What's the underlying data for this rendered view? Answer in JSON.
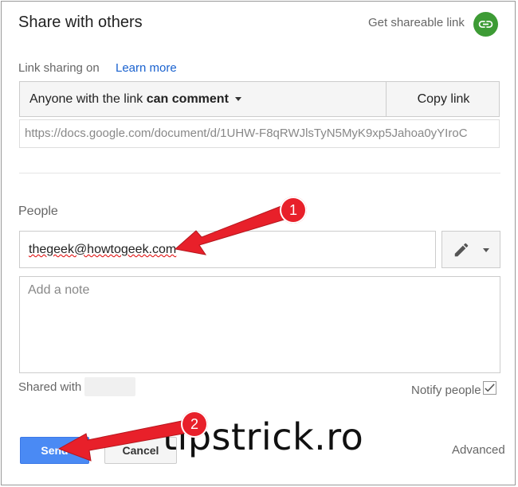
{
  "dialog": {
    "title": "Share with others",
    "get_shareable_link": "Get shareable link",
    "link_icon": "link-icon"
  },
  "link_sharing": {
    "status": "Link sharing on",
    "learn_more": "Learn more",
    "permission_prefix": "Anyone with the link ",
    "permission_level": "can comment",
    "copy_link": "Copy link",
    "url": "https://docs.google.com/document/d/1UHW-F8qRWJlsTyN5MyK9xp5Jahoa0yYIroC"
  },
  "people": {
    "label": "People",
    "input_value": "thegeek@howtogeek.com",
    "edit_icon": "pencil-icon",
    "note_placeholder": "Add a note"
  },
  "footer": {
    "shared_with": "Shared with",
    "notify_people": "Notify people",
    "notify_checked": true,
    "send": "Send",
    "cancel": "Cancel",
    "advanced": "Advanced"
  },
  "annotations": {
    "badge_1": "1",
    "badge_2": "2",
    "color": "#e8202a"
  },
  "watermark": "tipstrick.ro"
}
